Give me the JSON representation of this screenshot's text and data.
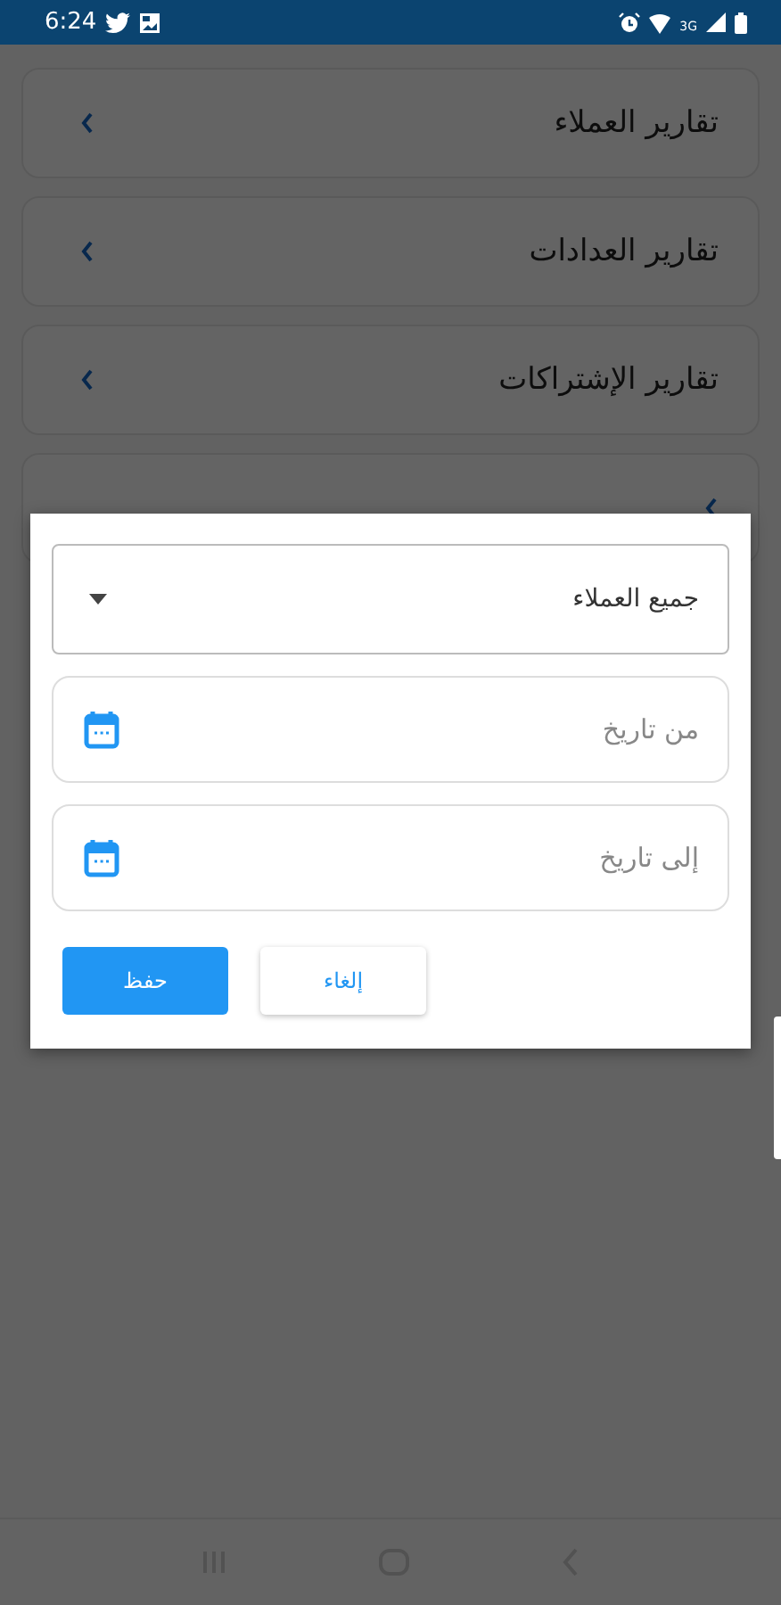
{
  "status_bar": {
    "time": "6:24",
    "network": "3G"
  },
  "menu_items": [
    {
      "label": "تقارير العملاء"
    },
    {
      "label": "تقارير العدادات"
    },
    {
      "label": "تقارير الإشتراكات"
    }
  ],
  "dialog": {
    "select": {
      "value": "جميع العملاء"
    },
    "fields": [
      {
        "placeholder": "من تاريخ"
      },
      {
        "placeholder": "إلى تاريخ"
      }
    ],
    "buttons": [
      {
        "label": "إلغاء",
        "kind": "secondary"
      },
      {
        "label": "حفظ",
        "kind": "primary"
      }
    ]
  }
}
